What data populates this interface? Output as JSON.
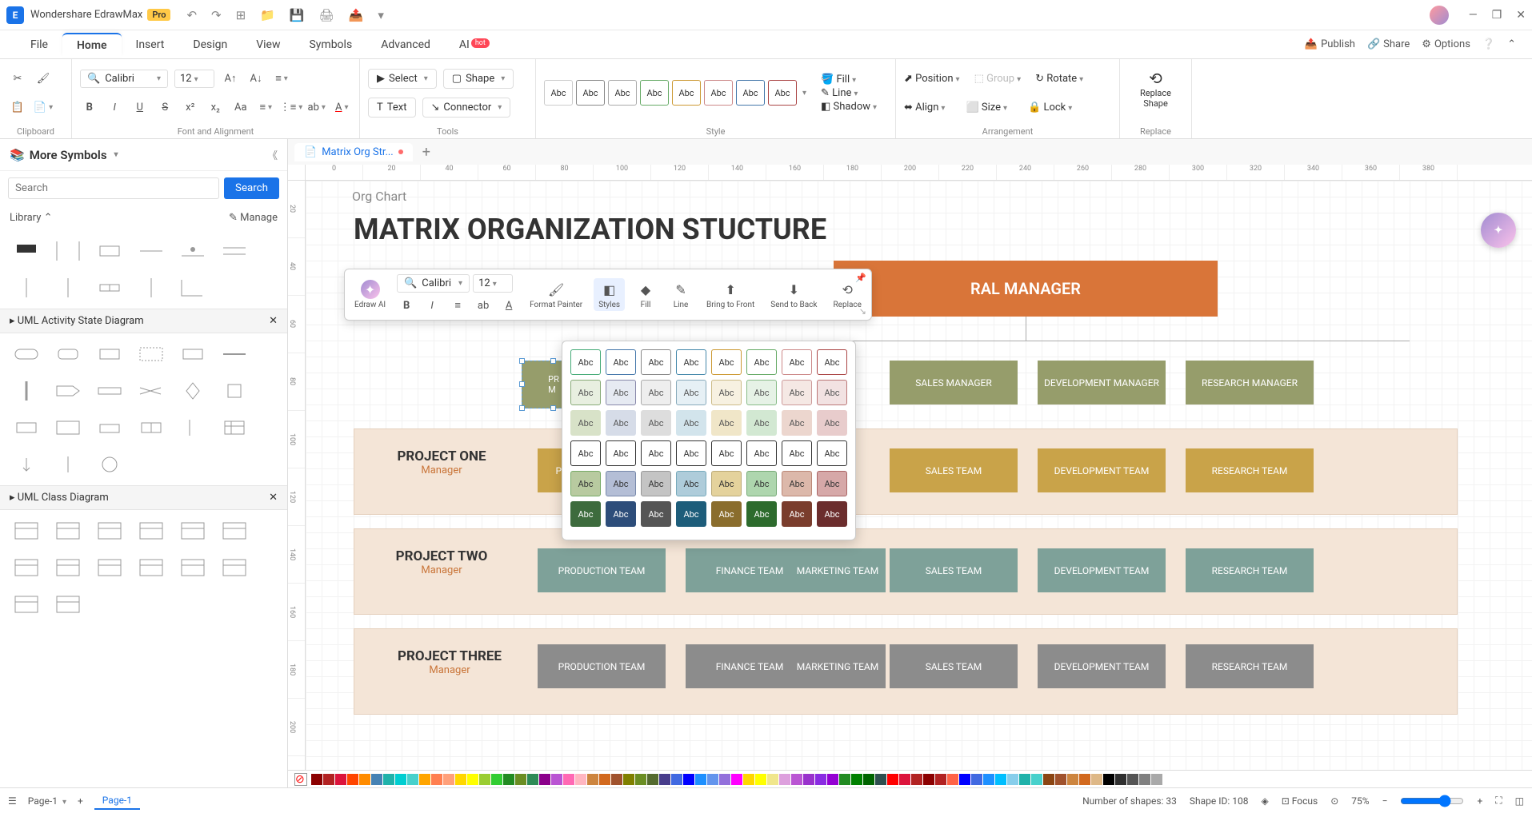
{
  "app": {
    "name": "Wondershare EdrawMax",
    "badge": "Pro"
  },
  "titlebar_icons": [
    "↶",
    "↷",
    "⊞",
    "📁",
    "💾",
    "🖨",
    "📤",
    "▾"
  ],
  "menu": [
    "File",
    "Home",
    "Insert",
    "Design",
    "View",
    "Symbols",
    "Advanced",
    "AI"
  ],
  "menu_active": "Home",
  "ai_hot": "hot",
  "menubar_right": {
    "publish": "Publish",
    "share": "Share",
    "options": "Options"
  },
  "ribbon": {
    "clipboard": "Clipboard",
    "font_align": "Font and Alignment",
    "tools": "Tools",
    "style": "Style",
    "arrangement": "Arrangement",
    "replace": "Replace",
    "font": "Calibri",
    "size": "12",
    "select": "Select",
    "shape": "Shape",
    "text": "Text",
    "connector": "Connector",
    "fill": "Fill",
    "line": "Line",
    "shadow": "Shadow",
    "position": "Position",
    "group": "Group",
    "rotate": "Rotate",
    "align": "Align",
    "sizebtn": "Size",
    "lock": "Lock",
    "replace_shape": "Replace Shape",
    "abc": "Abc"
  },
  "sidebar": {
    "title": "More Symbols",
    "search_ph": "Search",
    "search_btn": "Search",
    "library": "Library",
    "manage": "Manage",
    "cat1": "UML Activity State Diagram",
    "cat2": "UML Class Diagram"
  },
  "doc_tab": "Matrix Org Str...",
  "ruler_h": [
    "0",
    "20",
    "40",
    "60",
    "80",
    "100",
    "120",
    "140",
    "160",
    "180",
    "200",
    "220",
    "240",
    "260",
    "280",
    "300",
    "320",
    "340",
    "360",
    "380"
  ],
  "ruler_v": [
    "20",
    "40",
    "60",
    "80",
    "100",
    "120",
    "140",
    "160",
    "180",
    "200"
  ],
  "float": {
    "edrawai": "Edraw AI",
    "font": "Calibri",
    "size": "12",
    "format_painter": "Format Painter",
    "styles": "Styles",
    "fill": "Fill",
    "line": "Line",
    "btf": "Bring to Front",
    "stb": "Send to Back",
    "replace": "Replace"
  },
  "chart": {
    "subtitle": "Org Chart",
    "title": "MATRIX ORGANIZATION STUCTURE",
    "gm": "RAL MANAGER",
    "mgr_partial": "PR\nM",
    "managers": [
      "SALES MANAGER",
      "DEVELOPMENT MANAGER",
      "RESEARCH MANAGER"
    ],
    "projects": [
      {
        "name": "PROJECT ONE",
        "mgr": "Manager"
      },
      {
        "name": "PROJECT TWO",
        "mgr": "Manager"
      },
      {
        "name": "PROJECT THREE",
        "mgr": "Manager"
      }
    ],
    "team1_partial": "PR",
    "teams": [
      "PRODUCTION TEAM",
      "FINANCE TEAM",
      "MARKETING TEAM",
      "SALES TEAM",
      "DEVELOPMENT TEAM",
      "RESEARCH TEAM"
    ]
  },
  "style_rows": [
    [
      {
        "b": "#fff",
        "c": "#333",
        "br": "#4a7"
      },
      {
        "b": "#fff",
        "c": "#333",
        "br": "#47a"
      },
      {
        "b": "#fff",
        "c": "#333",
        "br": "#888"
      },
      {
        "b": "#fff",
        "c": "#333",
        "br": "#48a"
      },
      {
        "b": "#fff",
        "c": "#333",
        "br": "#c93"
      },
      {
        "b": "#fff",
        "c": "#333",
        "br": "#6a6"
      },
      {
        "b": "#fff",
        "c": "#333",
        "br": "#c88"
      },
      {
        "b": "#fff",
        "c": "#333",
        "br": "#a44"
      }
    ],
    [
      {
        "b": "#e8efe0",
        "c": "#555",
        "br": "#8a7"
      },
      {
        "b": "#e6eaf2",
        "c": "#555",
        "br": "#88a"
      },
      {
        "b": "#eee",
        "c": "#555",
        "br": "#aaa"
      },
      {
        "b": "#e6f0f5",
        "c": "#555",
        "br": "#8ab"
      },
      {
        "b": "#f7f1e1",
        "c": "#555",
        "br": "#cb8"
      },
      {
        "b": "#e6f2e6",
        "c": "#555",
        "br": "#8b8"
      },
      {
        "b": "#f5e8e4",
        "c": "#555",
        "br": "#c99"
      },
      {
        "b": "#f2e2e2",
        "c": "#555",
        "br": "#b77"
      }
    ],
    [
      {
        "b": "#d8e2c8",
        "c": "#555",
        "br": "none"
      },
      {
        "b": "#d6dce8",
        "c": "#555",
        "br": "none"
      },
      {
        "b": "#ddd",
        "c": "#555",
        "br": "none"
      },
      {
        "b": "#d2e4ec",
        "c": "#555",
        "br": "none"
      },
      {
        "b": "#f0e6c8",
        "c": "#555",
        "br": "none"
      },
      {
        "b": "#d2e8d2",
        "c": "#555",
        "br": "none"
      },
      {
        "b": "#ecd6ce",
        "c": "#555",
        "br": "none"
      },
      {
        "b": "#e8cccc",
        "c": "#555",
        "br": "none"
      }
    ],
    [
      {
        "b": "#fff",
        "c": "#333",
        "br": "#333"
      },
      {
        "b": "#fff",
        "c": "#333",
        "br": "#333"
      },
      {
        "b": "#fff",
        "c": "#333",
        "br": "#333"
      },
      {
        "b": "#fff",
        "c": "#333",
        "br": "#333"
      },
      {
        "b": "#fff",
        "c": "#333",
        "br": "#333"
      },
      {
        "b": "#fff",
        "c": "#333",
        "br": "#333"
      },
      {
        "b": "#fff",
        "c": "#333",
        "br": "#333"
      },
      {
        "b": "#fff",
        "c": "#333",
        "br": "#333"
      }
    ],
    [
      {
        "b": "#b8caa0",
        "c": "#333",
        "br": "#7a6"
      },
      {
        "b": "#b4bed6",
        "c": "#333",
        "br": "#78a"
      },
      {
        "b": "#c4c4c4",
        "c": "#333",
        "br": "#999"
      },
      {
        "b": "#aeccda",
        "c": "#333",
        "br": "#7ab"
      },
      {
        "b": "#e4d29c",
        "c": "#333",
        "br": "#ba7"
      },
      {
        "b": "#aed6ae",
        "c": "#333",
        "br": "#7a7"
      },
      {
        "b": "#dcb8aa",
        "c": "#333",
        "br": "#b87"
      },
      {
        "b": "#d6a8a8",
        "c": "#333",
        "br": "#a66"
      }
    ],
    [
      {
        "b": "#3d6b3d",
        "c": "#fff",
        "br": "none"
      },
      {
        "b": "#2d4d7a",
        "c": "#fff",
        "br": "none"
      },
      {
        "b": "#555",
        "c": "#fff",
        "br": "none"
      },
      {
        "b": "#1d5d7a",
        "c": "#fff",
        "br": "none"
      },
      {
        "b": "#8a6d2d",
        "c": "#fff",
        "br": "none"
      },
      {
        "b": "#2d6b2d",
        "c": "#fff",
        "br": "none"
      },
      {
        "b": "#7a3d2d",
        "c": "#fff",
        "br": "none"
      },
      {
        "b": "#6b2d2d",
        "c": "#fff",
        "br": "none"
      }
    ]
  ],
  "colors": [
    "#8B0000",
    "#B22222",
    "#DC143C",
    "#FF4500",
    "#FF8C00",
    "#4682B4",
    "#20B2AA",
    "#00CED1",
    "#48D1CC",
    "#FFA500",
    "#FF7F50",
    "#FFA07A",
    "#FFD700",
    "#FFFF00",
    "#9ACD32",
    "#32CD32",
    "#228B22",
    "#6B8E23",
    "#2E8B57",
    "#8B008B",
    "#BA55D3",
    "#FF69B4",
    "#FFB6C1",
    "#CD853F",
    "#D2691E",
    "#A0522D",
    "#808000",
    "#6B8E23",
    "#556B2F",
    "#483D8B",
    "#4169E1",
    "#0000FF",
    "#1E90FF",
    "#6495ED",
    "#9370DB",
    "#FF00FF",
    "#FFD700",
    "#FFFF00",
    "#F0E68C",
    "#DDA0DD",
    "#BA55D3",
    "#9932CC",
    "#8A2BE2",
    "#9400D3",
    "#228B22",
    "#008000",
    "#006400",
    "#2F4F4F",
    "#FF0000",
    "#DC143C",
    "#B22222",
    "#8B0000",
    "#B22222",
    "#FF6347",
    "#0000FF",
    "#4169E1",
    "#1E90FF",
    "#00BFFF",
    "#87CEEB",
    "#20B2AA",
    "#48D1CC",
    "#8B4513",
    "#A0522D",
    "#CD853F",
    "#D2691E",
    "#DEB887",
    "#000000",
    "#2F2F2F",
    "#555555",
    "#808080",
    "#A9A9A9",
    "#FFFFFF"
  ],
  "status": {
    "page": "Page-1",
    "page_tab": "Page-1",
    "shapes": "Number of shapes: 33",
    "shapeid": "Shape ID: 108",
    "focus": "Focus",
    "zoom": "75%"
  }
}
